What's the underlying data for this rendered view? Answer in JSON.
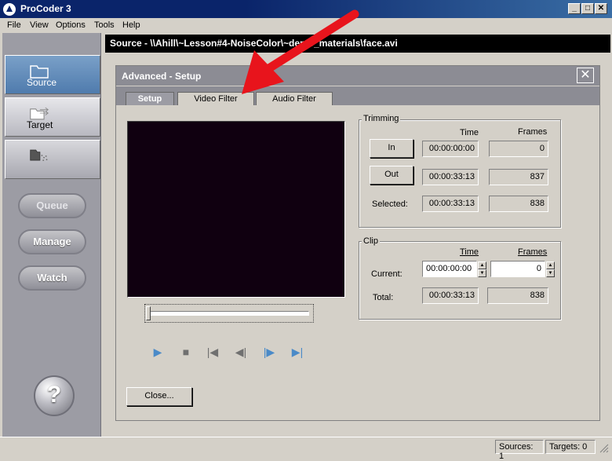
{
  "window": {
    "title": "ProCoder 3"
  },
  "menu": [
    "File",
    "View",
    "Options",
    "Tools",
    "Help"
  ],
  "sidebar": {
    "nav": [
      {
        "label": "Source",
        "state": "active"
      },
      {
        "label": "Target",
        "state": "normal"
      },
      {
        "label": "",
        "state": "disabled"
      }
    ],
    "buttons": {
      "queue": "Queue",
      "manage": "Manage",
      "watch": "Watch"
    },
    "help_glyph": "?"
  },
  "source_bar": {
    "text": "Source - \\\\Ahill\\~Lesson#4-NoiseColor\\~demo_materials\\face.avi"
  },
  "dialog": {
    "title": "Advanced - Setup",
    "close_glyph": "✕",
    "tabs": [
      "Setup",
      "Video Filter",
      "Audio Filter"
    ],
    "active_tab": "Setup",
    "trimming": {
      "label": "Trimming",
      "col_time": "Time",
      "col_frames": "Frames",
      "in_button": "In",
      "out_button": "Out",
      "selected_label": "Selected:",
      "in_time": "00:00:00:00",
      "in_frames": "0",
      "out_time": "00:00:33:13",
      "out_frames": "837",
      "selected_time": "00:00:33:13",
      "selected_frames": "838"
    },
    "clip": {
      "label": "Clip",
      "col_time": "Time",
      "col_frames": "Frames",
      "current_label": "Current:",
      "total_label": "Total:",
      "current_time": "00:00:00:00",
      "current_frames": "0",
      "total_time": "00:00:33:13",
      "total_frames": "838"
    },
    "close_button": "Close..."
  },
  "status": {
    "sources": "Sources: 1",
    "targets": "Targets: 0"
  },
  "colors": {
    "title_bar": "#0a246a",
    "annotation_arrow": "#e8141c",
    "video_bg": "#100010"
  }
}
